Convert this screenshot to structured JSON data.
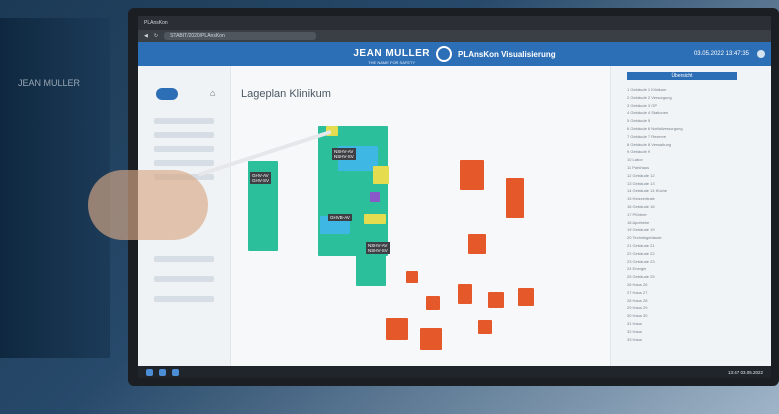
{
  "browser": {
    "tab_label": "PLAnsKon",
    "address": "STABIT/2020/PLAnsKon"
  },
  "left_monitor": {
    "brand_text": "JEAN MULLER"
  },
  "header": {
    "brand": "JEAN MULLER",
    "tagline": "THE NAME FOR SAFETY",
    "app": "PLAnsKon Visualisierung",
    "datetime": "03.05.2022 13:47:35"
  },
  "page": {
    "title": "Lageplan Klinikum"
  },
  "map_labels": {
    "gh1": "GHV-AV\nGHV-SV",
    "nshv1": "NSHV-AV\nNSHV-SV",
    "ghvb": "GHVB-AV",
    "nshv2": "NSHV-AV\nNSHV-SV"
  },
  "panel": {
    "title": "Übersicht",
    "items": [
      "1 Gebäude 1 Klinikum",
      "2 Gebäude 2 Versorgung",
      "3 Gebäude 3 OP",
      "4 Gebäude 4 Stationen",
      "5 Gebäude 5",
      "6 Gebäude 6 Notfallversorgung",
      "7 Gebäude 7 Reserve",
      "8 Gebäude 8 Verwaltung",
      "9 Gebäude 9",
      "10 Labor",
      "11 Parkhaus",
      "12 Gebäude 12",
      "13 Gebäude 13",
      "14 Gebäude 14 Küche",
      "15 Heizzentrale",
      "16 Gebäude 16",
      "17 Pförtner",
      "18 Apotheke",
      "19 Gebäude 19",
      "20 Technikgebäude",
      "21 Gebäude 21",
      "22 Gebäude 22",
      "23 Gebäude 23",
      "24 Energie",
      "25 Gebäude 25",
      "26 Haus 26",
      "27 Haus 27",
      "28 Haus 28",
      "29 Haus 29",
      "30 Haus 30",
      "31 Haus",
      "32 Haus",
      "33 Haus"
    ]
  },
  "taskbar": {
    "time": "13:47",
    "date": "03.05.2022"
  }
}
